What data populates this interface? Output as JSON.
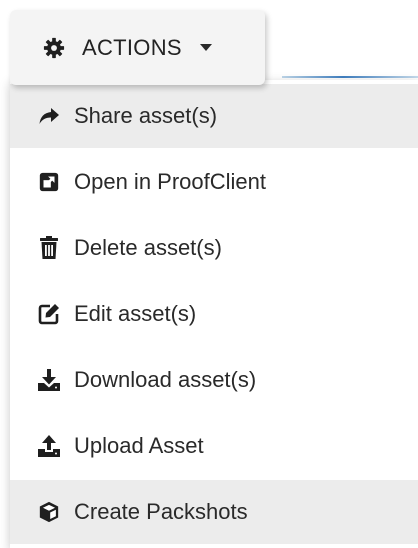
{
  "header": {
    "actions_label": "ACTIONS",
    "actions_icon": "cog-icon",
    "caret_icon": "caret-down-icon",
    "accent_color": "#3f7fc0"
  },
  "menu": {
    "items": [
      {
        "label": "Share asset(s)",
        "icon": "share-icon",
        "highlighted": true
      },
      {
        "label": "Open in ProofClient",
        "icon": "external-link-square-icon",
        "highlighted": false
      },
      {
        "label": "Delete asset(s)",
        "icon": "trash-icon",
        "highlighted": false
      },
      {
        "label": "Edit asset(s)",
        "icon": "edit-icon",
        "highlighted": false
      },
      {
        "label": "Download asset(s)",
        "icon": "download-icon",
        "highlighted": false
      },
      {
        "label": "Upload Asset",
        "icon": "upload-icon",
        "highlighted": false
      },
      {
        "label": "Create Packshots",
        "icon": "cube-icon",
        "highlighted": true
      }
    ],
    "highlight_color": "#ececec"
  }
}
